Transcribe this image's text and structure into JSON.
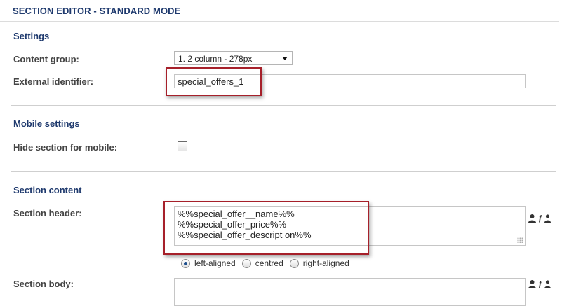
{
  "header": {
    "title": "SECTION EDITOR - STANDARD MODE"
  },
  "settings": {
    "heading": "Settings",
    "content_group_label": "Content group:",
    "content_group_value": "1. 2 column - 278px",
    "external_identifier_label": "External identifier:",
    "external_identifier_value": "special_offers_1"
  },
  "mobile": {
    "heading": "Mobile settings",
    "hide_label": "Hide section for mobile:",
    "hide_checked": false
  },
  "content": {
    "heading": "Section content",
    "header_label": "Section header:",
    "header_lines": [
      "%%special_offer__name%%",
      "%%special_offer_price%%",
      "%%special_offer_descript on%%"
    ],
    "alignment_options": [
      "left-aligned",
      "centred",
      "right-aligned"
    ],
    "alignment_selected": "left-aligned",
    "body_label": "Section body:",
    "body_value": ""
  },
  "icons": {
    "personalize": "person-icon",
    "function": "function-person-icon"
  },
  "colors": {
    "heading": "#1f3a6e",
    "highlight": "#a6202a"
  }
}
